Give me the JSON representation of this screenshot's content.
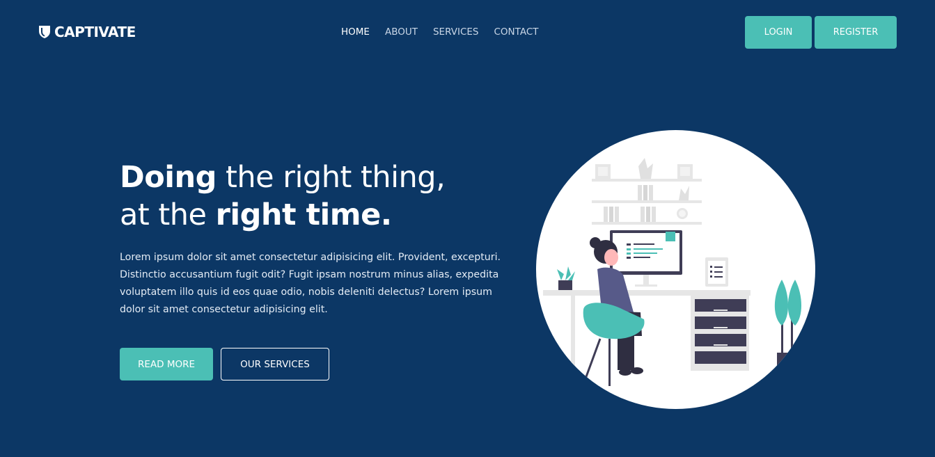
{
  "brand": {
    "name": "CAPTIVATE",
    "icon": "shield-icon"
  },
  "nav": {
    "items": [
      {
        "label": "HOME",
        "active": true
      },
      {
        "label": "ABOUT",
        "active": false
      },
      {
        "label": "SERVICES",
        "active": false
      },
      {
        "label": "CONTACT",
        "active": false
      }
    ],
    "login_label": "LOGIN",
    "register_label": "REGISTER"
  },
  "hero": {
    "headline_line1_bold": "Doing",
    "headline_line1_rest": " the right thing,",
    "headline_line2_pre": "at the ",
    "headline_line2_bold": "right time.",
    "paragraph": "Lorem ipsum dolor sit amet consectetur adipisicing elit. Provident, excepturi. Distinctio accusantium fugit odit? Fugit ipsam nostrum minus alias, expedita voluptatem illo quis id eos quae odio, nobis deleniti delectus? Lorem ipsum dolor sit amet consectetur adipisicing elit.",
    "read_more_label": "READ MORE",
    "our_services_label": "OUR SERVICES",
    "illustration": "person-at-desk-illustration"
  },
  "colors": {
    "background": "#0c3765",
    "accent": "#4bbfb5",
    "text": "#ffffff"
  }
}
